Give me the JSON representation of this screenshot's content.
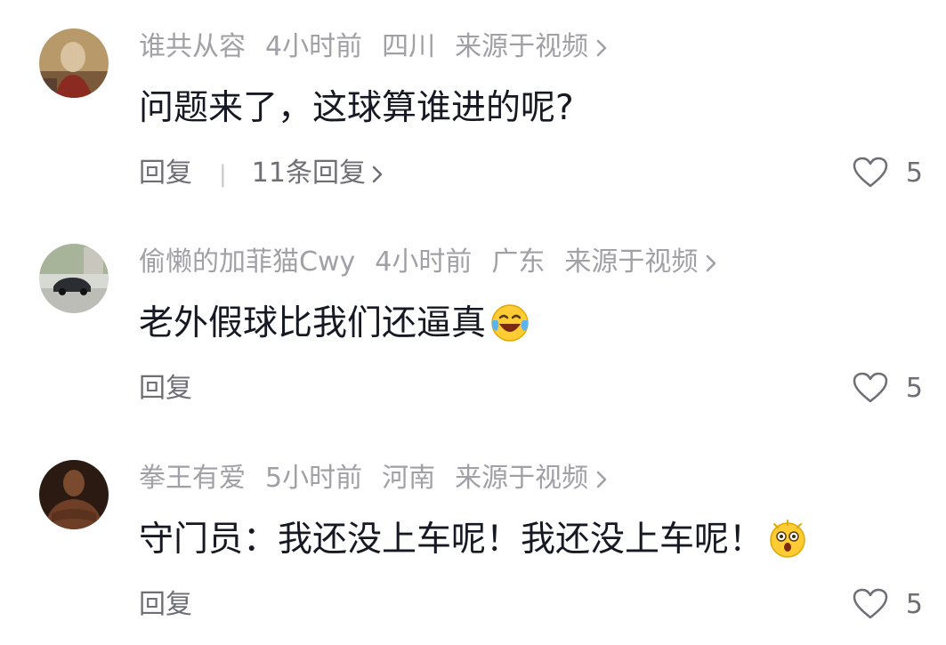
{
  "comments": [
    {
      "username": "谁共从容",
      "time": "4小时前",
      "location": "四川",
      "source": "来源于视频",
      "text": "问题来了，这球算谁进的呢?",
      "reply_label": "回复",
      "replies_label": "11条回复",
      "likes": "5",
      "avatar_icon": "avatar-portrait-icon"
    },
    {
      "username": "偷懒的加菲猫Cwy",
      "time": "4小时前",
      "location": "广东",
      "source": "来源于视频",
      "text": "老外假球比我们还逼真",
      "emoji": "crying-laughing-emoji",
      "reply_label": "回复",
      "likes": "5",
      "avatar_icon": "avatar-car-icon"
    },
    {
      "username": "拳王有爱",
      "time": "5小时前",
      "location": "河南",
      "source": "来源于视频",
      "text": "守门员：我还没上车呢！我还没上车呢！",
      "emoji": "shocked-face-emoji",
      "reply_label": "回复",
      "likes": "5",
      "avatar_icon": "avatar-boxer-icon"
    }
  ]
}
